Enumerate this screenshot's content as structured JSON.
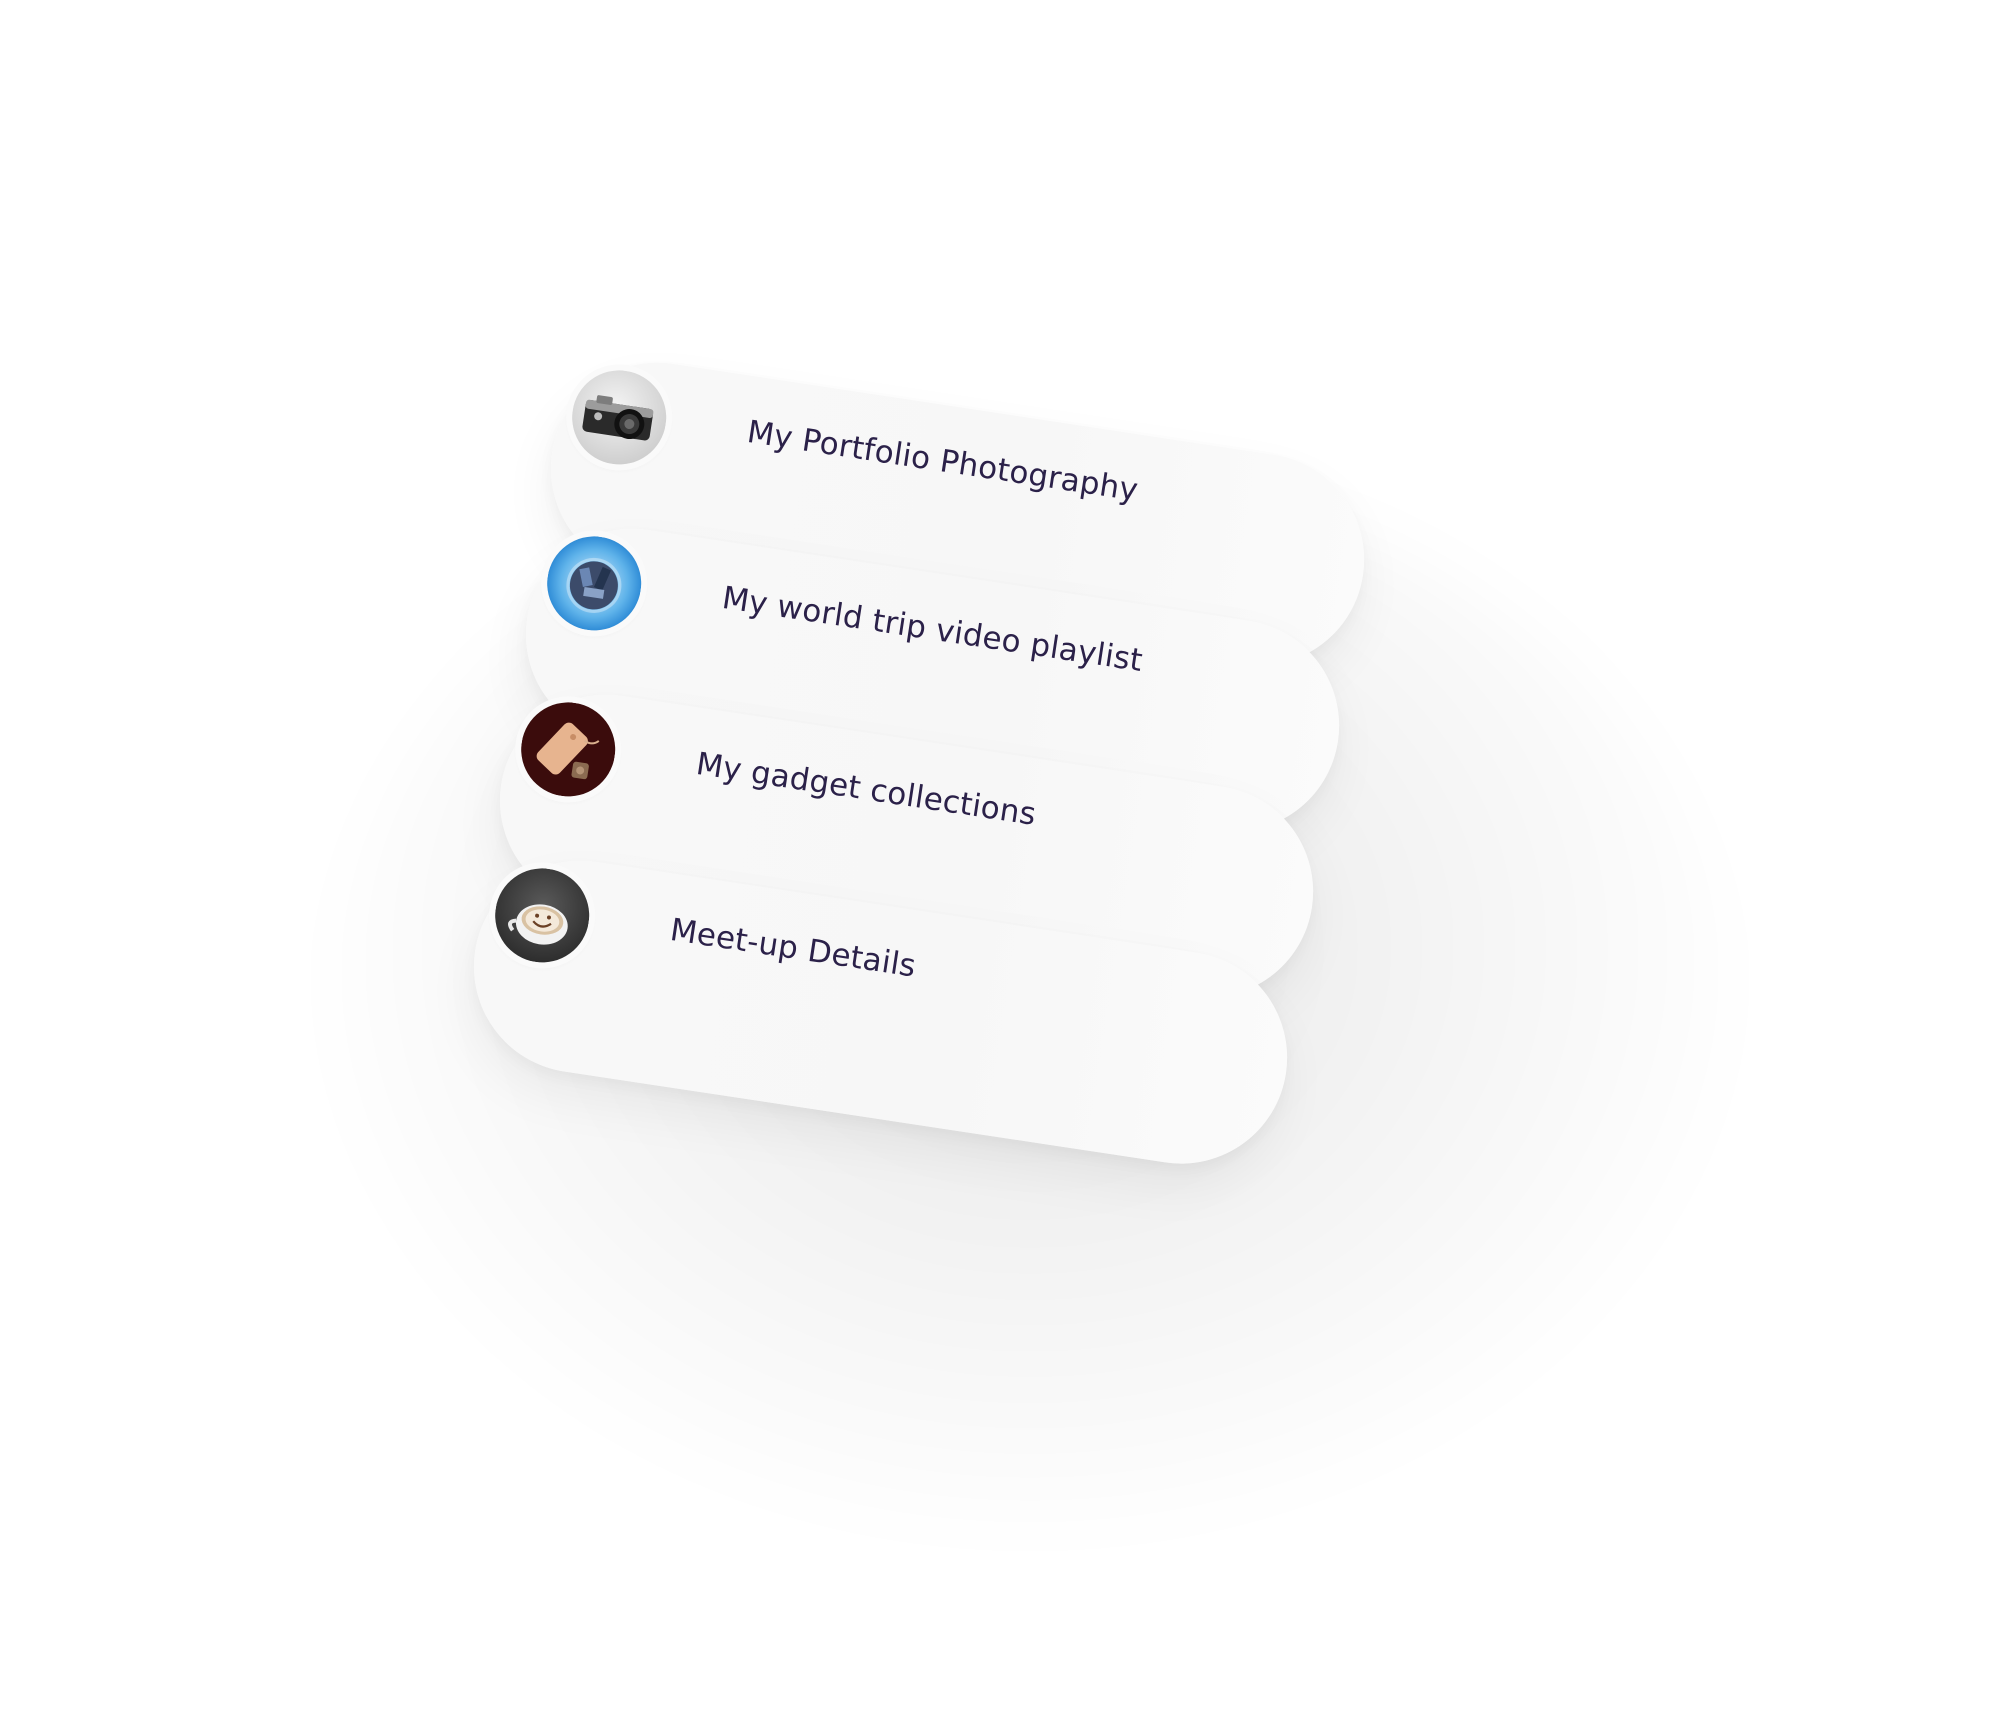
{
  "links": [
    {
      "label": "My Portfolio Photography",
      "icon": "camera-icon"
    },
    {
      "label": "My world trip video playlist",
      "icon": "globe-icon"
    },
    {
      "label": "My gadget collections",
      "icon": "phone-icon"
    },
    {
      "label": "Meet-up Details",
      "icon": "coffee-cup-icon"
    }
  ],
  "colors": {
    "label_text": "#2b2149",
    "card_background": "#f8f8f8"
  }
}
